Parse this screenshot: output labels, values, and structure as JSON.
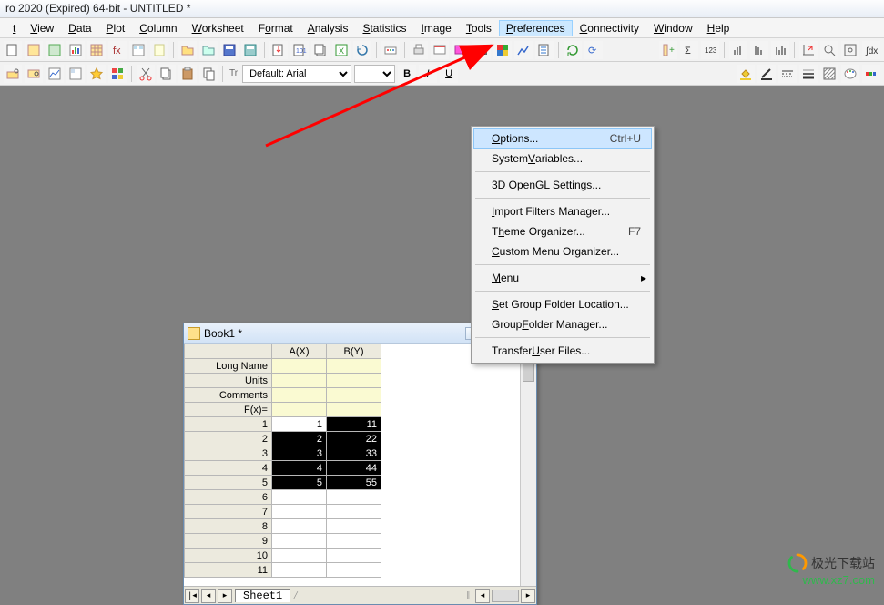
{
  "title": "ro 2020 (Expired) 64-bit - UNTITLED *",
  "menubar": {
    "items": [
      {
        "label": "t",
        "ul": "t"
      },
      {
        "label": "View",
        "ul": "V"
      },
      {
        "label": "Data",
        "ul": "D"
      },
      {
        "label": "Plot",
        "ul": "P"
      },
      {
        "label": "Column",
        "ul": "C"
      },
      {
        "label": "Worksheet",
        "ul": "W"
      },
      {
        "label": "Format",
        "ul": "o"
      },
      {
        "label": "Analysis",
        "ul": "A"
      },
      {
        "label": "Statistics",
        "ul": "S"
      },
      {
        "label": "Image",
        "ul": "I"
      },
      {
        "label": "Tools",
        "ul": "T"
      },
      {
        "label": "Preferences",
        "ul": "P",
        "active": true
      },
      {
        "label": "Connectivity",
        "ul": "C"
      },
      {
        "label": "Window",
        "ul": "W"
      },
      {
        "label": "Help",
        "ul": "H"
      }
    ]
  },
  "dropdown": {
    "items": [
      {
        "label": "Options...",
        "ul": "O",
        "shortcut": "Ctrl+U",
        "hl": true
      },
      {
        "label": "System Variables...",
        "ul": "V"
      },
      {
        "sep": true
      },
      {
        "label": "3D OpenGL Settings...",
        "ul": "G"
      },
      {
        "sep": true
      },
      {
        "label": "Import Filters Manager...",
        "ul": "I"
      },
      {
        "label": "Theme Organizer...",
        "ul": "h",
        "shortcut": "F7"
      },
      {
        "label": "Custom Menu Organizer...",
        "ul": "C"
      },
      {
        "sep": true
      },
      {
        "label": "Menu",
        "ul": "M",
        "submenu": true
      },
      {
        "sep": true
      },
      {
        "label": "Set Group Folder Location...",
        "ul": "S"
      },
      {
        "label": "Group Folder Manager...",
        "ul": "F"
      },
      {
        "sep": true
      },
      {
        "label": "Transfer User Files...",
        "ul": "U"
      }
    ]
  },
  "format_toolbar": {
    "font_prefix": "Tr",
    "font": "Default: Arial",
    "size": "",
    "bold": "B",
    "italic": "I",
    "underline": "U"
  },
  "book": {
    "title": "Book1 *",
    "columns": [
      "A(X)",
      "B(Y)"
    ],
    "meta_rows": [
      "Long Name",
      "Units",
      "Comments",
      "F(x)="
    ],
    "data": [
      {
        "n": "1",
        "a": "1",
        "b": "11"
      },
      {
        "n": "2",
        "a": "2",
        "b": "22"
      },
      {
        "n": "3",
        "a": "3",
        "b": "33"
      },
      {
        "n": "4",
        "a": "4",
        "b": "44"
      },
      {
        "n": "5",
        "a": "5",
        "b": "55"
      }
    ],
    "empty_rows": [
      "6",
      "7",
      "8",
      "9",
      "10",
      "11"
    ],
    "sheet": "Sheet1"
  },
  "watermark": {
    "l1": "极光下载站",
    "l2": "www.xz7.com"
  }
}
